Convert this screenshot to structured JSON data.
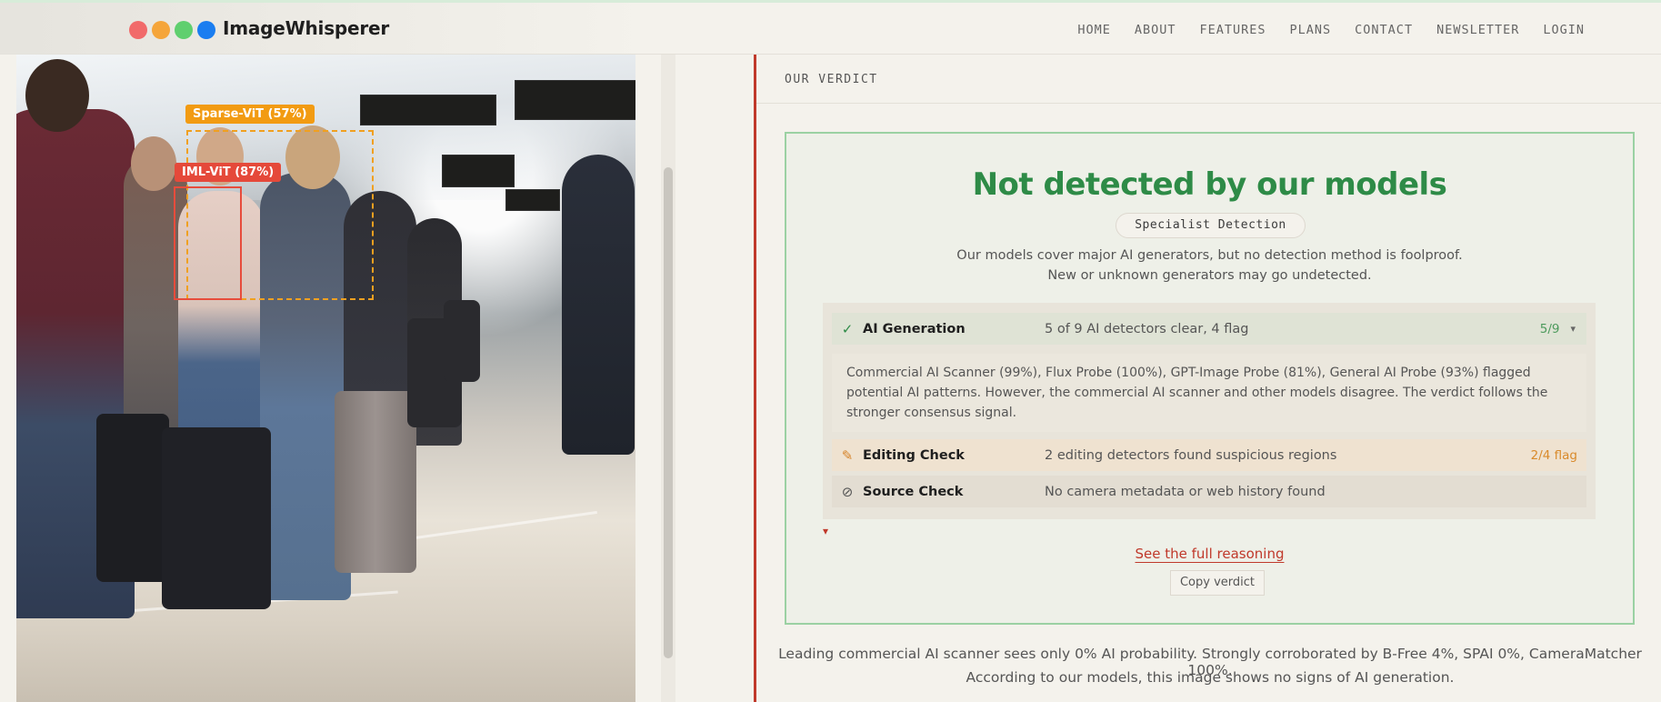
{
  "header": {
    "brand": "ImageWhisperer",
    "dots": [
      "#f16a6a",
      "#f5a53a",
      "#5fcf6e",
      "#1a7df0"
    ],
    "nav": [
      "HOME",
      "ABOUT",
      "FEATURES",
      "PLANS",
      "CONTACT",
      "NEWSLETTER",
      "LOGIN"
    ]
  },
  "image_panel": {
    "detections": [
      {
        "label": "Sparse-ViT (57%)",
        "color": "#f29b12"
      },
      {
        "label": "IML-ViT (87%)",
        "color": "#e5493a"
      }
    ]
  },
  "verdict": {
    "section_label": "OUR VERDICT",
    "headline": "Not detected by our models",
    "pill": "Specialist Detection",
    "disclaimer_line1": "Our models cover major AI generators, but no detection method is foolproof.",
    "disclaimer_line2": "New or unknown generators may go undetected.",
    "checks": {
      "ai": {
        "label": "AI Generation",
        "summary": "5 of 9 AI detectors clear, 4 flag",
        "count": "5/9",
        "icon": "check-icon",
        "detail": "Commercial AI Scanner (99%), Flux Probe (100%), GPT-Image Probe (81%), General AI Probe (93%) flagged potential AI patterns. However, the commercial AI scanner and other models disagree. The verdict follows the stronger consensus signal."
      },
      "editing": {
        "label": "Editing Check",
        "summary": "2 editing detectors found suspicious regions",
        "count": "2/4 flag",
        "icon": "pencil-icon"
      },
      "source": {
        "label": "Source Check",
        "summary": "No camera metadata or web history found",
        "icon": "prohibited-icon"
      }
    },
    "reasoning_link": "See the full reasoning",
    "copy_button": "Copy verdict"
  },
  "summary": {
    "line1": "Leading commercial AI scanner sees only 0% AI probability. Strongly corroborated by B-Free 4%, SPAI 0%, CameraMatcher 100%.",
    "line2": "According to our models, this image shows no signs of AI generation."
  }
}
